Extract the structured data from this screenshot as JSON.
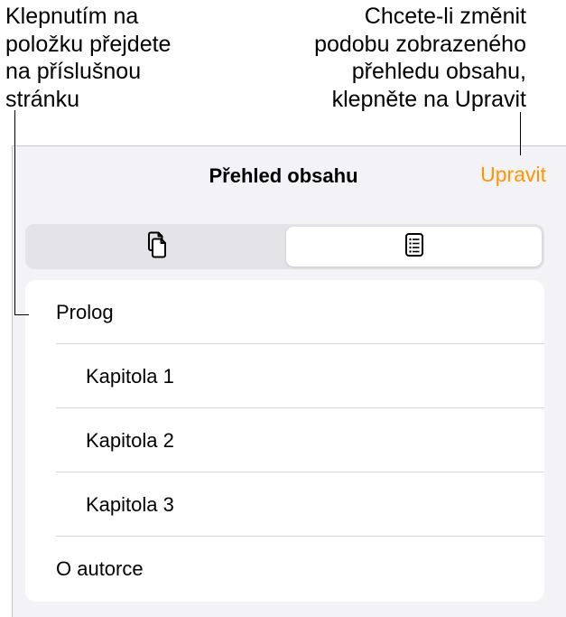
{
  "annotations": {
    "left": {
      "lines": [
        "Klepnutím na",
        "položku přejdete",
        "na příslušnou",
        "stránku"
      ]
    },
    "right": {
      "lines": [
        "Chcete-li změnit",
        "podobu zobrazeného",
        "přehledu obsahu,",
        "klepněte na Upravit"
      ]
    }
  },
  "header": {
    "title": "Přehled obsahu",
    "edit_label": "Upravit"
  },
  "view_switcher": {
    "options": [
      {
        "name": "pages-view",
        "icon": "pages-icon",
        "selected": false
      },
      {
        "name": "list-view",
        "icon": "list-icon",
        "selected": true
      }
    ]
  },
  "toc": {
    "items": [
      {
        "label": "Prolog",
        "level": 0
      },
      {
        "label": "Kapitola 1",
        "level": 1
      },
      {
        "label": "Kapitola 2",
        "level": 1
      },
      {
        "label": "Kapitola 3",
        "level": 1
      },
      {
        "label": "O autorce",
        "level": 0
      }
    ]
  },
  "colors": {
    "accent": "#ff9500",
    "panel_bg": "#f2f2f7",
    "segment_bg": "#e3e3e8"
  }
}
